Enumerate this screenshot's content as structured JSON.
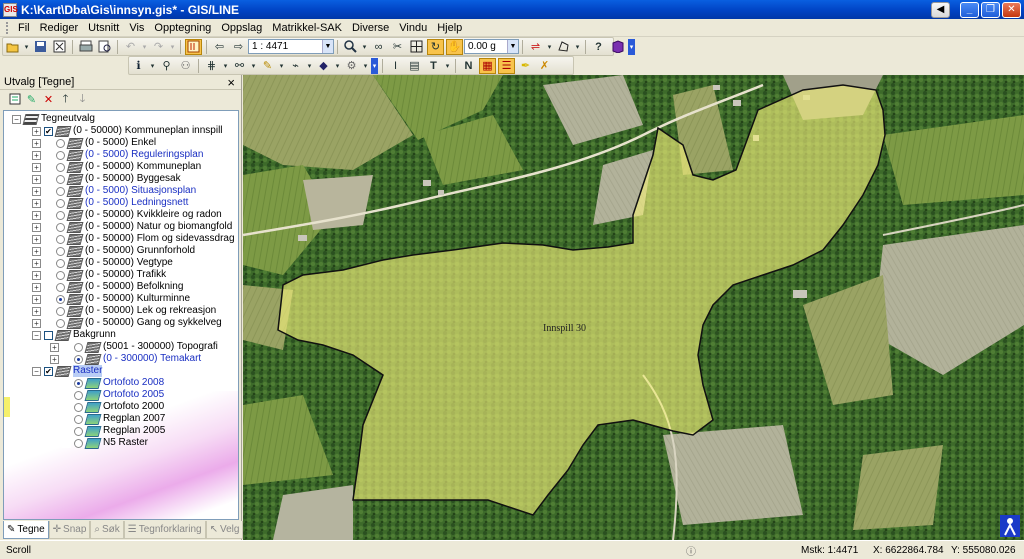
{
  "app": {
    "icon_text": "GIS",
    "title": "K:\\Kart\\Dba\\Gis\\innsyn.gis* - GIS/LINE",
    "window_buttons": {
      "back": "◀",
      "minimize": "_",
      "maximize": "❐",
      "close": "✕"
    }
  },
  "menu": [
    "Fil",
    "Rediger",
    "Utsnitt",
    "Vis",
    "Opptegning",
    "Oppslag",
    "Matrikkel-SAK",
    "Diverse",
    "Vindu",
    "Hjelp"
  ],
  "toolbar1": {
    "scale_value": "1 : 4471",
    "dropdown_arrow": "▼",
    "zoom_value": "0.00 g"
  },
  "panel": {
    "title": "Utvalg [Tegne]",
    "close": "×",
    "tree": [
      {
        "text": "Tegneutvalg",
        "exp": "−",
        "chk": "",
        "radio": "",
        "icon": "root",
        "blue": false
      },
      {
        "text": "(0 - 50000) Kommuneplan innspill",
        "exp": "+",
        "chk": "✔",
        "radio": "",
        "icon": "layer",
        "blue": false
      },
      {
        "text": "(0 - 5000) Enkel",
        "exp": "+",
        "chk": "",
        "radio": "off",
        "icon": "layer",
        "blue": false
      },
      {
        "text": "(0 - 5000) Reguleringsplan",
        "exp": "+",
        "chk": "",
        "radio": "off",
        "icon": "layer",
        "blue": true
      },
      {
        "text": "(0 - 50000) Kommuneplan",
        "exp": "+",
        "chk": "",
        "radio": "off",
        "icon": "layer",
        "blue": false
      },
      {
        "text": "(0 - 50000) Byggesak",
        "exp": "+",
        "chk": "",
        "radio": "off",
        "icon": "layer",
        "blue": false
      },
      {
        "text": "(0 - 5000) Situasjonsplan",
        "exp": "+",
        "chk": "",
        "radio": "off",
        "icon": "layer",
        "blue": true
      },
      {
        "text": "(0 - 5000) Ledningsnett",
        "exp": "+",
        "chk": "",
        "radio": "off",
        "icon": "layer",
        "blue": true
      },
      {
        "text": "(0 - 50000) Kvikkleire og radon",
        "exp": "+",
        "chk": "",
        "radio": "off",
        "icon": "layer",
        "blue": false
      },
      {
        "text": "(0 - 50000) Natur og biomangfold",
        "exp": "+",
        "chk": "",
        "radio": "off",
        "icon": "layer",
        "blue": false
      },
      {
        "text": "(0 - 50000) Flom og sidevassdrag",
        "exp": "+",
        "chk": "",
        "radio": "off",
        "icon": "layer",
        "blue": false
      },
      {
        "text": "(0 - 50000) Grunnforhold",
        "exp": "+",
        "chk": "",
        "radio": "off",
        "icon": "layer",
        "blue": false
      },
      {
        "text": "(0 - 50000) Vegtype",
        "exp": "+",
        "chk": "",
        "radio": "off",
        "icon": "layer",
        "blue": false
      },
      {
        "text": "(0 - 50000) Trafikk",
        "exp": "+",
        "chk": "",
        "radio": "off",
        "icon": "layer",
        "blue": false
      },
      {
        "text": "(0 - 50000) Befolkning",
        "exp": "+",
        "chk": "",
        "radio": "off",
        "icon": "layer",
        "blue": false
      },
      {
        "text": "(0 - 50000) Kulturminne",
        "exp": "+",
        "chk": "",
        "radio": "on",
        "icon": "layer",
        "blue": false
      },
      {
        "text": "(0 - 50000) Lek og rekreasjon",
        "exp": "+",
        "chk": "",
        "radio": "off",
        "icon": "layer",
        "blue": false
      },
      {
        "text": "(0 - 50000) Gang og sykkelveg",
        "exp": "+",
        "chk": "",
        "radio": "off",
        "icon": "layer",
        "blue": false
      },
      {
        "text": "Bakgrunn",
        "exp": "−",
        "chk": " ",
        "radio": "",
        "icon": "layer",
        "blue": false
      },
      {
        "text": "(5001 - 300000) Topografi",
        "exp": "+",
        "chk": "",
        "radio": "off",
        "icon": "layer",
        "blue": false,
        "indent": 1
      },
      {
        "text": "(0 - 300000) Temakart",
        "exp": "+",
        "chk": "",
        "radio": "on",
        "icon": "layer",
        "blue": true,
        "indent": 1
      },
      {
        "text": "Raster",
        "exp": "−",
        "chk": "✔",
        "radio": "",
        "icon": "layer",
        "blue": true,
        "sel": true
      },
      {
        "text": "Ortofoto 2008",
        "exp": "",
        "chk": "",
        "radio": "on",
        "icon": "raster",
        "blue": true,
        "indent": 1
      },
      {
        "text": "Ortofoto 2005",
        "exp": "",
        "chk": "",
        "radio": "off",
        "icon": "raster",
        "blue": true,
        "indent": 1
      },
      {
        "text": "Ortofoto 2000",
        "exp": "",
        "chk": "",
        "radio": "off",
        "icon": "raster",
        "blue": false,
        "indent": 1
      },
      {
        "text": "Regplan 2007",
        "exp": "",
        "chk": "",
        "radio": "off",
        "icon": "raster",
        "blue": false,
        "indent": 1
      },
      {
        "text": "Regplan 2005",
        "exp": "",
        "chk": "",
        "radio": "off",
        "icon": "raster",
        "blue": false,
        "indent": 1
      },
      {
        "text": "N5 Raster",
        "exp": "",
        "chk": "",
        "radio": "off",
        "icon": "raster",
        "blue": false,
        "indent": 1
      }
    ],
    "tabs": [
      {
        "label": "Tegne",
        "icon": "✎",
        "active": true
      },
      {
        "label": "Snap",
        "icon": "✛",
        "active": false
      },
      {
        "label": "Søk",
        "icon": "⌕",
        "active": false
      },
      {
        "label": "Tegnforklaring",
        "icon": "☰",
        "active": false
      },
      {
        "label": "Velg",
        "icon": "↖",
        "active": false
      }
    ]
  },
  "map": {
    "polygon_label": "Innspill 30",
    "polygon_fill": "#f4f07a",
    "polygon_stroke": "#111111"
  },
  "status": {
    "left": "Scroll",
    "info_icon": "ⓘ",
    "scale": "Mstk: 1:4471",
    "x": "X: 6622864.784",
    "y": "Y: 555080.026"
  },
  "colors": {
    "titlebar": "#0a5fe0",
    "highlight_text": "#1a2fc2"
  }
}
